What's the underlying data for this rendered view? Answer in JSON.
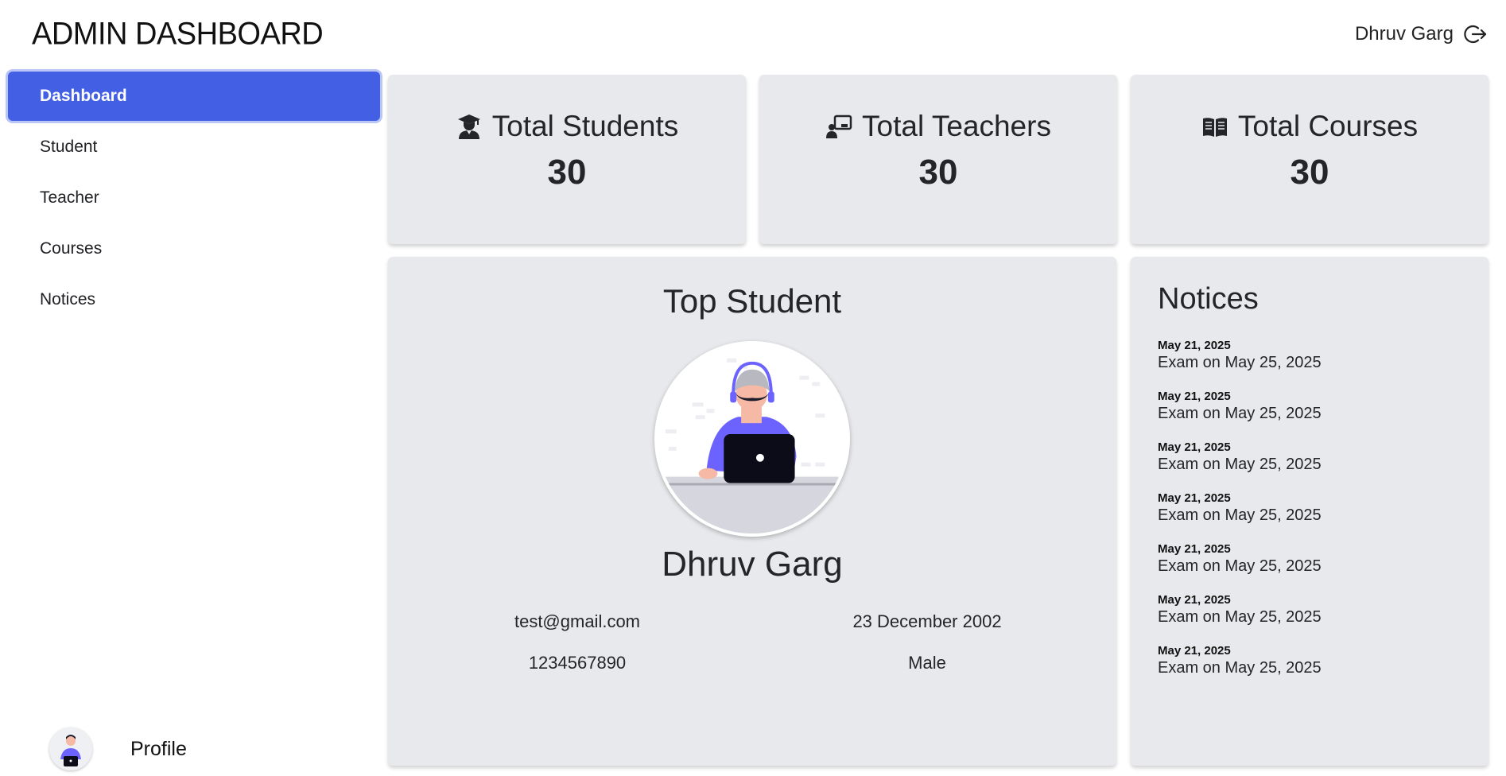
{
  "header": {
    "title": "ADMIN DASHBOARD",
    "user_name": "Dhruv Garg"
  },
  "sidebar": {
    "items": [
      {
        "label": "Dashboard"
      },
      {
        "label": "Student"
      },
      {
        "label": "Teacher"
      },
      {
        "label": "Courses"
      },
      {
        "label": "Notices"
      }
    ],
    "profile_label": "Profile"
  },
  "stats": [
    {
      "title": "Total Students",
      "value": "30",
      "icon": "graduate-icon"
    },
    {
      "title": "Total Teachers",
      "value": "30",
      "icon": "teacher-board-icon"
    },
    {
      "title": "Total Courses",
      "value": "30",
      "icon": "book-icon"
    }
  ],
  "top_student": {
    "heading": "Top Student",
    "name": "Dhruv Garg",
    "email": "test@gmail.com",
    "dob": "23 December 2002",
    "phone": "1234567890",
    "gender": "Male"
  },
  "notices": {
    "heading": "Notices",
    "items": [
      {
        "date": "May 21, 2025",
        "text": "Exam on May 25, 2025"
      },
      {
        "date": "May 21, 2025",
        "text": "Exam on May 25, 2025"
      },
      {
        "date": "May 21, 2025",
        "text": "Exam on May 25, 2025"
      },
      {
        "date": "May 21, 2025",
        "text": "Exam on May 25, 2025"
      },
      {
        "date": "May 21, 2025",
        "text": "Exam on May 25, 2025"
      },
      {
        "date": "May 21, 2025",
        "text": "Exam on May 25, 2025"
      },
      {
        "date": "May 21, 2025",
        "text": "Exam on May 25, 2025"
      }
    ]
  },
  "colors": {
    "accent": "#4360e4",
    "card_bg": "#e8e9ec",
    "avatar_shirt": "#6c63ff"
  }
}
